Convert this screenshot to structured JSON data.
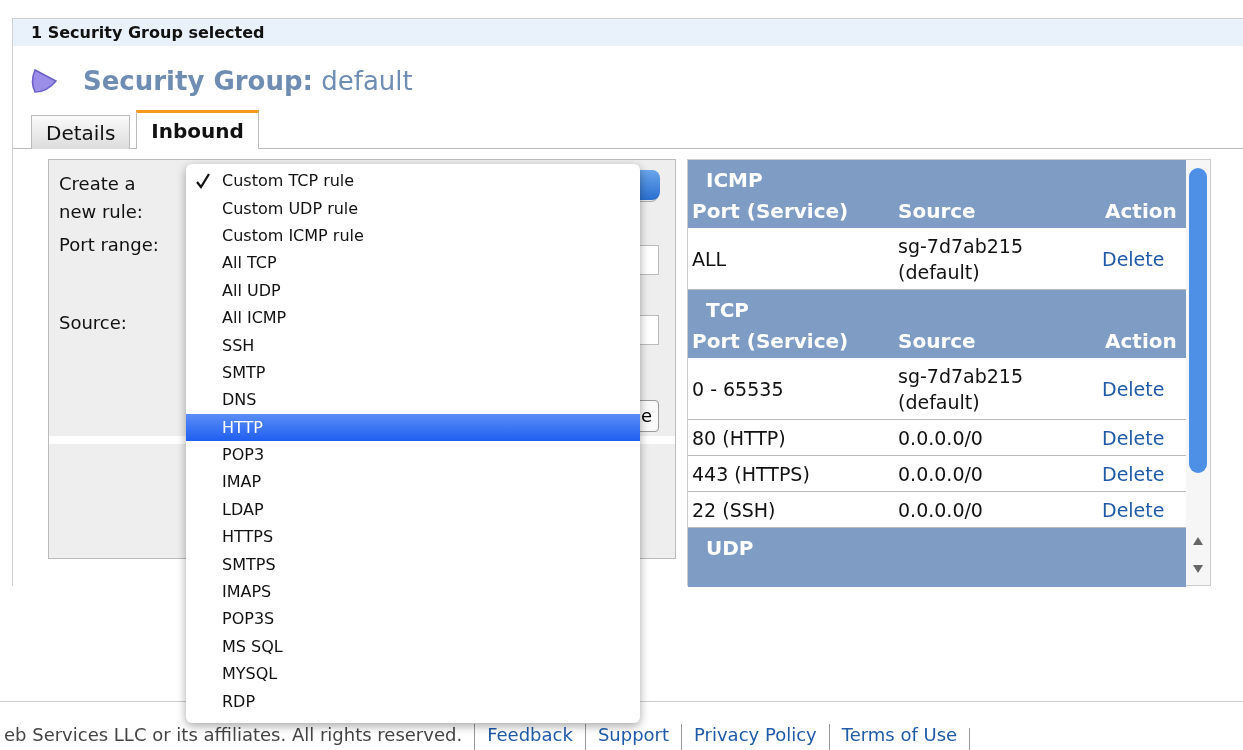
{
  "selection_bar": {
    "text": "1 Security Group selected"
  },
  "title": {
    "label": "Security Group:",
    "name": "default"
  },
  "tabs": [
    {
      "label": "Details",
      "selected": false
    },
    {
      "label": "Inbound",
      "selected": true
    }
  ],
  "rule_form": {
    "labels": [
      "Create a\nnew rule:",
      "Port range:",
      "Source:"
    ],
    "add_button": "e"
  },
  "rule_menu": {
    "items": [
      {
        "label": "Custom TCP rule",
        "checked": true,
        "selected": false
      },
      {
        "label": "Custom UDP rule",
        "checked": false,
        "selected": false
      },
      {
        "label": "Custom ICMP rule",
        "checked": false,
        "selected": false
      },
      {
        "label": "All TCP",
        "checked": false,
        "selected": false
      },
      {
        "label": "All UDP",
        "checked": false,
        "selected": false
      },
      {
        "label": "All ICMP",
        "checked": false,
        "selected": false
      },
      {
        "label": "SSH",
        "checked": false,
        "selected": false
      },
      {
        "label": "SMTP",
        "checked": false,
        "selected": false
      },
      {
        "label": "DNS",
        "checked": false,
        "selected": false
      },
      {
        "label": "HTTP",
        "checked": false,
        "selected": true
      },
      {
        "label": "POP3",
        "checked": false,
        "selected": false
      },
      {
        "label": "IMAP",
        "checked": false,
        "selected": false
      },
      {
        "label": "LDAP",
        "checked": false,
        "selected": false
      },
      {
        "label": "HTTPS",
        "checked": false,
        "selected": false
      },
      {
        "label": "SMTPS",
        "checked": false,
        "selected": false
      },
      {
        "label": "IMAPS",
        "checked": false,
        "selected": false
      },
      {
        "label": "POP3S",
        "checked": false,
        "selected": false
      },
      {
        "label": "MS SQL",
        "checked": false,
        "selected": false
      },
      {
        "label": "MYSQL",
        "checked": false,
        "selected": false
      },
      {
        "label": "RDP",
        "checked": false,
        "selected": false
      }
    ]
  },
  "rule_tables": [
    {
      "protocol": "ICMP",
      "columns": [
        "Port (Service)",
        "Source",
        "Action"
      ],
      "rows": [
        {
          "port": "ALL",
          "source": "sg-7d7ab215 (default)",
          "action": "Delete"
        }
      ]
    },
    {
      "protocol": "TCP",
      "columns": [
        "Port (Service)",
        "Source",
        "Action"
      ],
      "rows": [
        {
          "port": "0 - 65535",
          "source": "sg-7d7ab215 (default)",
          "action": "Delete"
        },
        {
          "port": "80 (HTTP)",
          "source": "0.0.0.0/0",
          "action": "Delete"
        },
        {
          "port": "443 (HTTPS)",
          "source": "0.0.0.0/0",
          "action": "Delete"
        },
        {
          "port": "22 (SSH)",
          "source": "0.0.0.0/0",
          "action": "Delete"
        }
      ]
    },
    {
      "protocol": "UDP"
    }
  ],
  "footer": {
    "copyright": "eb Services LLC or its affiliates. All rights reserved.",
    "links": [
      "Feedback",
      "Support",
      "Privacy Policy",
      "Terms of Use"
    ]
  }
}
